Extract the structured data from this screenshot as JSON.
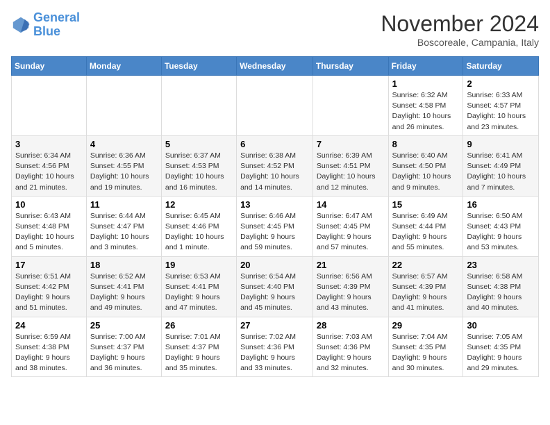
{
  "logo": {
    "line1": "General",
    "line2": "Blue"
  },
  "title": "November 2024",
  "location": "Boscoreale, Campania, Italy",
  "days_of_week": [
    "Sunday",
    "Monday",
    "Tuesday",
    "Wednesday",
    "Thursday",
    "Friday",
    "Saturday"
  ],
  "weeks": [
    [
      {
        "day": "",
        "info": ""
      },
      {
        "day": "",
        "info": ""
      },
      {
        "day": "",
        "info": ""
      },
      {
        "day": "",
        "info": ""
      },
      {
        "day": "",
        "info": ""
      },
      {
        "day": "1",
        "info": "Sunrise: 6:32 AM\nSunset: 4:58 PM\nDaylight: 10 hours and 26 minutes."
      },
      {
        "day": "2",
        "info": "Sunrise: 6:33 AM\nSunset: 4:57 PM\nDaylight: 10 hours and 23 minutes."
      }
    ],
    [
      {
        "day": "3",
        "info": "Sunrise: 6:34 AM\nSunset: 4:56 PM\nDaylight: 10 hours and 21 minutes."
      },
      {
        "day": "4",
        "info": "Sunrise: 6:36 AM\nSunset: 4:55 PM\nDaylight: 10 hours and 19 minutes."
      },
      {
        "day": "5",
        "info": "Sunrise: 6:37 AM\nSunset: 4:53 PM\nDaylight: 10 hours and 16 minutes."
      },
      {
        "day": "6",
        "info": "Sunrise: 6:38 AM\nSunset: 4:52 PM\nDaylight: 10 hours and 14 minutes."
      },
      {
        "day": "7",
        "info": "Sunrise: 6:39 AM\nSunset: 4:51 PM\nDaylight: 10 hours and 12 minutes."
      },
      {
        "day": "8",
        "info": "Sunrise: 6:40 AM\nSunset: 4:50 PM\nDaylight: 10 hours and 9 minutes."
      },
      {
        "day": "9",
        "info": "Sunrise: 6:41 AM\nSunset: 4:49 PM\nDaylight: 10 hours and 7 minutes."
      }
    ],
    [
      {
        "day": "10",
        "info": "Sunrise: 6:43 AM\nSunset: 4:48 PM\nDaylight: 10 hours and 5 minutes."
      },
      {
        "day": "11",
        "info": "Sunrise: 6:44 AM\nSunset: 4:47 PM\nDaylight: 10 hours and 3 minutes."
      },
      {
        "day": "12",
        "info": "Sunrise: 6:45 AM\nSunset: 4:46 PM\nDaylight: 10 hours and 1 minute."
      },
      {
        "day": "13",
        "info": "Sunrise: 6:46 AM\nSunset: 4:45 PM\nDaylight: 9 hours and 59 minutes."
      },
      {
        "day": "14",
        "info": "Sunrise: 6:47 AM\nSunset: 4:45 PM\nDaylight: 9 hours and 57 minutes."
      },
      {
        "day": "15",
        "info": "Sunrise: 6:49 AM\nSunset: 4:44 PM\nDaylight: 9 hours and 55 minutes."
      },
      {
        "day": "16",
        "info": "Sunrise: 6:50 AM\nSunset: 4:43 PM\nDaylight: 9 hours and 53 minutes."
      }
    ],
    [
      {
        "day": "17",
        "info": "Sunrise: 6:51 AM\nSunset: 4:42 PM\nDaylight: 9 hours and 51 minutes."
      },
      {
        "day": "18",
        "info": "Sunrise: 6:52 AM\nSunset: 4:41 PM\nDaylight: 9 hours and 49 minutes."
      },
      {
        "day": "19",
        "info": "Sunrise: 6:53 AM\nSunset: 4:41 PM\nDaylight: 9 hours and 47 minutes."
      },
      {
        "day": "20",
        "info": "Sunrise: 6:54 AM\nSunset: 4:40 PM\nDaylight: 9 hours and 45 minutes."
      },
      {
        "day": "21",
        "info": "Sunrise: 6:56 AM\nSunset: 4:39 PM\nDaylight: 9 hours and 43 minutes."
      },
      {
        "day": "22",
        "info": "Sunrise: 6:57 AM\nSunset: 4:39 PM\nDaylight: 9 hours and 41 minutes."
      },
      {
        "day": "23",
        "info": "Sunrise: 6:58 AM\nSunset: 4:38 PM\nDaylight: 9 hours and 40 minutes."
      }
    ],
    [
      {
        "day": "24",
        "info": "Sunrise: 6:59 AM\nSunset: 4:38 PM\nDaylight: 9 hours and 38 minutes."
      },
      {
        "day": "25",
        "info": "Sunrise: 7:00 AM\nSunset: 4:37 PM\nDaylight: 9 hours and 36 minutes."
      },
      {
        "day": "26",
        "info": "Sunrise: 7:01 AM\nSunset: 4:37 PM\nDaylight: 9 hours and 35 minutes."
      },
      {
        "day": "27",
        "info": "Sunrise: 7:02 AM\nSunset: 4:36 PM\nDaylight: 9 hours and 33 minutes."
      },
      {
        "day": "28",
        "info": "Sunrise: 7:03 AM\nSunset: 4:36 PM\nDaylight: 9 hours and 32 minutes."
      },
      {
        "day": "29",
        "info": "Sunrise: 7:04 AM\nSunset: 4:35 PM\nDaylight: 9 hours and 30 minutes."
      },
      {
        "day": "30",
        "info": "Sunrise: 7:05 AM\nSunset: 4:35 PM\nDaylight: 9 hours and 29 minutes."
      }
    ]
  ]
}
